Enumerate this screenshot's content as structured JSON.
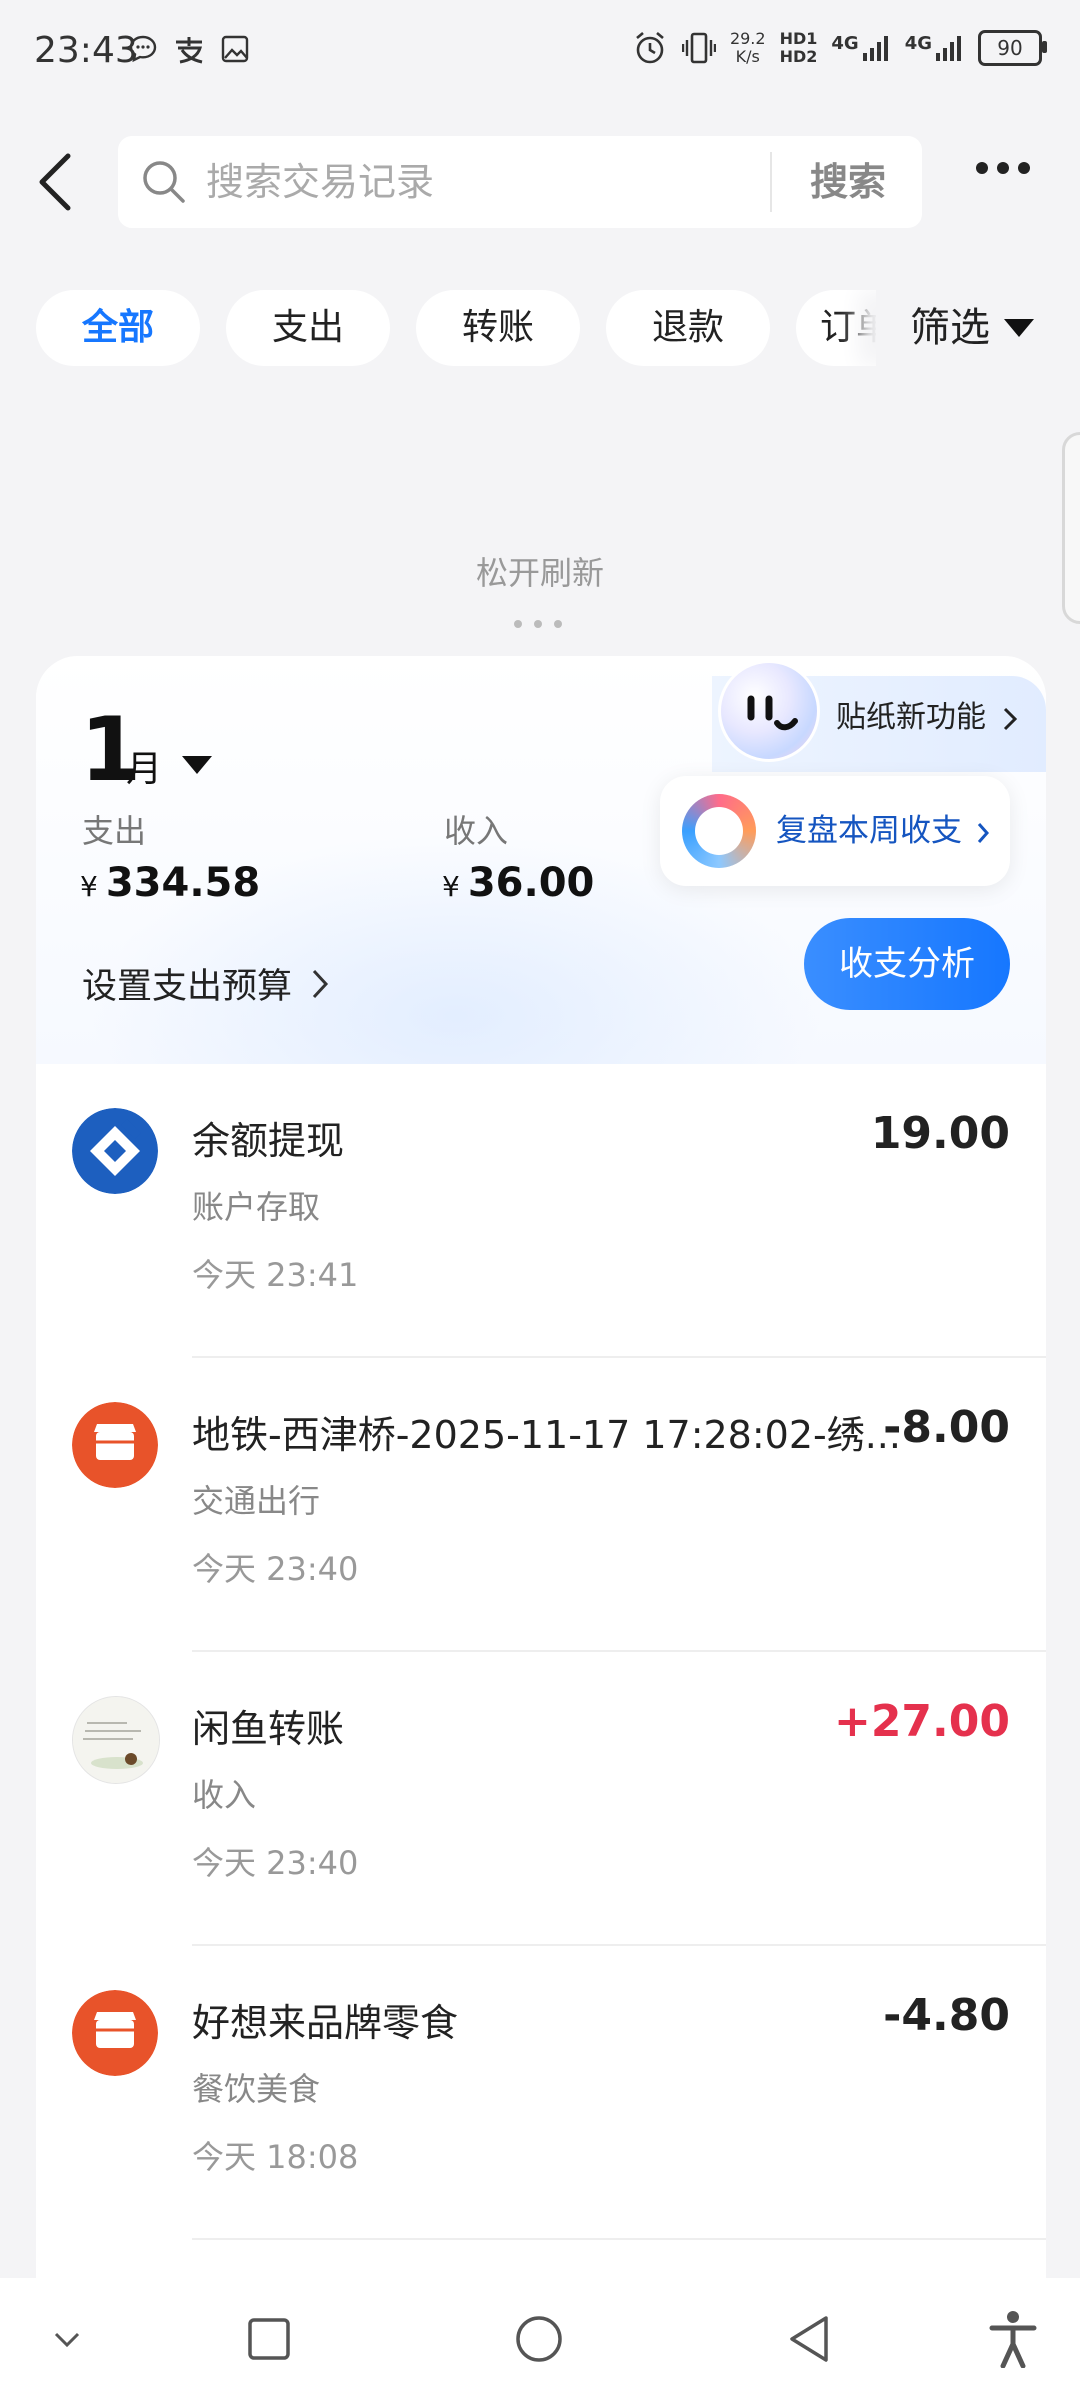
{
  "status_bar": {
    "time": "23:43",
    "net_speed_value": "29.2",
    "net_speed_unit": "K/s",
    "hd1": "HD1",
    "hd2": "HD2",
    "signal1": "4G",
    "signal2": "4G",
    "battery": "90"
  },
  "search": {
    "placeholder": "搜索交易记录",
    "button": "搜索"
  },
  "tabs": [
    {
      "label": "全部",
      "active": true
    },
    {
      "label": "支出"
    },
    {
      "label": "转账"
    },
    {
      "label": "退款"
    },
    {
      "label": "订单"
    }
  ],
  "filter": {
    "label": "筛选"
  },
  "refresh": {
    "label": "松开刷新"
  },
  "summary": {
    "month_number": "1",
    "month_suffix": "月",
    "sticker_label": "贴纸新功能",
    "weekly_review": "复盘本周收支",
    "expense_label": "支出",
    "expense_currency": "¥",
    "expense_value": "334.58",
    "income_label": "收入",
    "income_currency": "¥",
    "income_value": "36.00",
    "budget_label": "设置支出预算",
    "analysis_button": "收支分析"
  },
  "transactions": [
    {
      "title": "余额提现",
      "category": "账户存取",
      "time": "今天 23:41",
      "amount": "19.00",
      "icon": "bank-icon"
    },
    {
      "title": "地铁-西津桥-2025-11-17 17:28:02-绣...",
      "category": "交通出行",
      "time": "今天 23:40",
      "amount": "-8.00",
      "icon": "store-icon"
    },
    {
      "title": "闲鱼转账",
      "category": "收入",
      "time": "今天 23:40",
      "amount": "+27.00",
      "icon": "user-avatar-icon"
    },
    {
      "title": "好想来品牌零食",
      "category": "餐饮美食",
      "time": "今天 18:08",
      "amount": "-4.80",
      "icon": "store-icon"
    }
  ],
  "colors": {
    "accent": "#1677ff",
    "positive_amount": "#e5314d",
    "bank_blue": "#1d5fbf",
    "store_orange": "#e8532a"
  }
}
